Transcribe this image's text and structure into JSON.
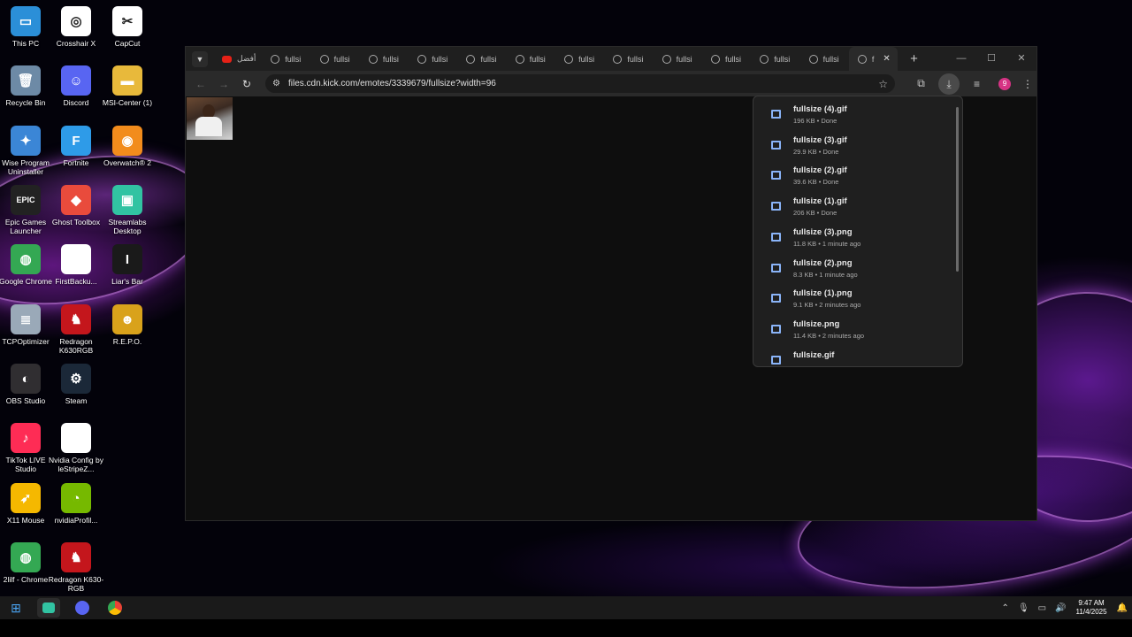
{
  "desktop": {
    "icons": [
      {
        "label": "This PC",
        "icon": "monitor-icon",
        "color": "#2b8fd8",
        "glyph": "▭"
      },
      {
        "label": "Crosshair X",
        "icon": "crosshair-icon",
        "color": "#ffffff",
        "glyph": "◎"
      },
      {
        "label": "CapCut",
        "icon": "capcut-icon",
        "color": "#ffffff",
        "glyph": "✂"
      },
      {
        "label": "Recycle Bin",
        "icon": "recycle-bin-icon",
        "color": "#6d8aa6",
        "glyph": "🗑"
      },
      {
        "label": "Discord",
        "icon": "discord-icon",
        "color": "#5865f2",
        "glyph": "☺"
      },
      {
        "label": "MSI-Center (1)",
        "icon": "folder-icon",
        "color": "#e8b93b",
        "glyph": "▬"
      },
      {
        "label": "Wise Program Uninstaller",
        "icon": "wise-icon",
        "color": "#3b86d6",
        "glyph": "✦"
      },
      {
        "label": "Fortnite",
        "icon": "fortnite-icon",
        "color": "#2e9be8",
        "glyph": "F"
      },
      {
        "label": "Overwatch® 2",
        "icon": "overwatch-icon",
        "color": "#f28c1c",
        "glyph": "◉"
      },
      {
        "label": "Epic Games Launcher",
        "icon": "epic-games-icon",
        "color": "#222222",
        "glyph": "EPIC"
      },
      {
        "label": "Ghost Toolbox",
        "icon": "ghost-toolbox-icon",
        "color": "#e94b3c",
        "glyph": "◆"
      },
      {
        "label": "Streamlabs Desktop",
        "icon": "streamlabs-icon",
        "color": "#31c3a2",
        "glyph": "▣"
      },
      {
        "label": "Google Chrome",
        "icon": "chrome-icon",
        "color": "#34a853",
        "glyph": "◍"
      },
      {
        "label": "FirstBacku...",
        "icon": "file-icon",
        "color": "#ffffff",
        "glyph": ""
      },
      {
        "label": "Liar's Bar",
        "icon": "liars-bar-icon",
        "color": "#1a1a1a",
        "glyph": "I"
      },
      {
        "label": "TCPOptimizer",
        "icon": "tcp-optimizer-icon",
        "color": "#9aa9b8",
        "glyph": "≣"
      },
      {
        "label": "Redragon K630RGB",
        "icon": "redragon-icon",
        "color": "#c4161c",
        "glyph": "♞"
      },
      {
        "label": "R.E.P.O.",
        "icon": "repo-icon",
        "color": "#d9a21b",
        "glyph": "☻"
      },
      {
        "label": "OBS Studio",
        "icon": "obs-icon",
        "color": "#302e31",
        "glyph": "◐"
      },
      {
        "label": "Steam",
        "icon": "steam-icon",
        "color": "#1b2838",
        "glyph": "⚙"
      },
      {
        "label": "TikTok LIVE Studio",
        "icon": "tiktok-icon",
        "color": "#fe2c55",
        "glyph": "♪"
      },
      {
        "label": "Nvidia Config by leStripeZ...",
        "icon": "file-icon",
        "color": "#ffffff",
        "glyph": ""
      },
      {
        "label": "X11 Mouse",
        "icon": "x11-mouse-icon",
        "color": "#f5b800",
        "glyph": "➶"
      },
      {
        "label": "nvidiaProfil...",
        "icon": "nvidia-icon",
        "color": "#76b900",
        "glyph": "◔"
      },
      {
        "label": "2lilf - Chrome",
        "icon": "chrome-icon",
        "color": "#34a853",
        "glyph": "◍"
      },
      {
        "label": "Redragon K630-RGB",
        "icon": "redragon-icon",
        "color": "#c4161c",
        "glyph": "♞"
      }
    ]
  },
  "browser": {
    "tabs": [
      {
        "label": "أفضل",
        "icon": "youtube-icon"
      },
      {
        "label": "fullsi",
        "icon": "globe-icon"
      },
      {
        "label": "fullsi",
        "icon": "globe-icon"
      },
      {
        "label": "fullsi",
        "icon": "globe-icon"
      },
      {
        "label": "fullsi",
        "icon": "globe-icon"
      },
      {
        "label": "fullsi",
        "icon": "globe-icon"
      },
      {
        "label": "fullsi",
        "icon": "globe-icon"
      },
      {
        "label": "fullsi",
        "icon": "globe-icon"
      },
      {
        "label": "fullsi",
        "icon": "globe-icon"
      },
      {
        "label": "fullsi",
        "icon": "globe-icon"
      },
      {
        "label": "fullsi",
        "icon": "globe-icon"
      },
      {
        "label": "fullsi",
        "icon": "globe-icon"
      },
      {
        "label": "fullsi",
        "icon": "globe-icon"
      },
      {
        "label": "f",
        "icon": "globe-icon",
        "active": true
      }
    ],
    "url": "files.cdn.kick.com/emotes/3339679/fullsize?width=96",
    "profile_badge": "9",
    "downloads": [
      {
        "name": "fullsize (4).gif",
        "meta": "196 KB • Done"
      },
      {
        "name": "fullsize (3).gif",
        "meta": "29.9 KB • Done"
      },
      {
        "name": "fullsize (2).gif",
        "meta": "39.6 KB • Done"
      },
      {
        "name": "fullsize (1).gif",
        "meta": "206 KB • Done"
      },
      {
        "name": "fullsize (3).png",
        "meta": "11.8 KB • 1 minute ago"
      },
      {
        "name": "fullsize (2).png",
        "meta": "8.3 KB • 1 minute ago"
      },
      {
        "name": "fullsize (1).png",
        "meta": "9.1 KB • 2 minutes ago"
      },
      {
        "name": "fullsize.png",
        "meta": "11.4 KB • 2 minutes ago"
      },
      {
        "name": "fullsize.gif",
        "meta": ""
      }
    ]
  },
  "taskbar": {
    "time": "9:47 AM",
    "date": "11/4/2025"
  }
}
